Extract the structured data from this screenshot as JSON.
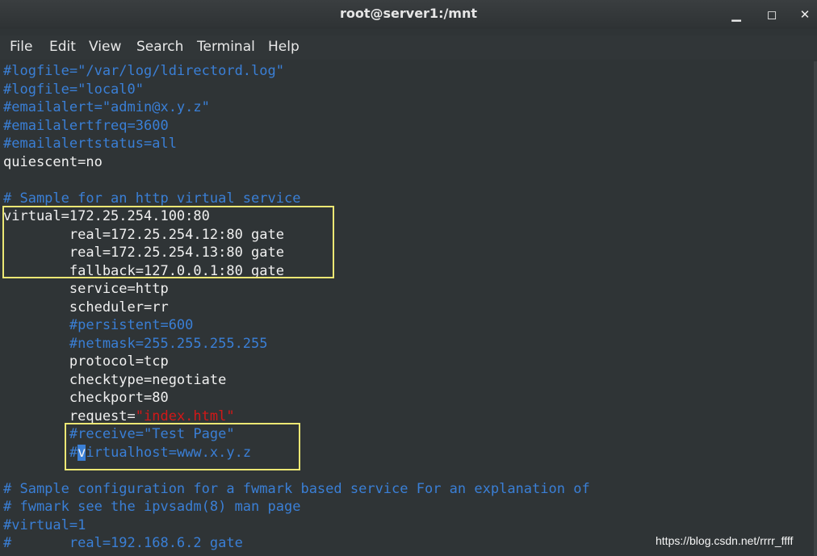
{
  "window": {
    "title": "root@server1:/mnt",
    "minimize_icon": "minimize-icon",
    "maximize_icon": "maximize-icon",
    "close_icon": "close-icon",
    "minimize_glyph": "▁",
    "maximize_glyph": "◻",
    "close_glyph": "✕"
  },
  "menu": [
    "File",
    "Edit",
    "View",
    "Search",
    "Terminal",
    "Help"
  ],
  "terminal": {
    "lines": [
      "#logfile=\"/var/log/ldirectord.log\"",
      "#logfile=\"local0\"",
      "#emailalert=\"admin@x.y.z\"",
      "#emailalertfreq=3600",
      "#emailalertstatus=all",
      "quiescent=no",
      "",
      "# Sample for an http virtual service",
      "virtual=172.25.254.100:80",
      "        real=172.25.254.12:80 gate",
      "        real=172.25.254.13:80 gate",
      "        fallback=127.0.0.1:80 gate",
      "        service=http",
      "        scheduler=rr",
      "        #persistent=600",
      "        #netmask=255.255.255.255",
      "        protocol=tcp",
      "        checktype=negotiate",
      "        checkport=80",
      "        request=",
      "        #receive=\"Test Page\"",
      "        #",
      "",
      "# Sample configuration for a fwmark based service For an explanation of",
      "# fwmark see the ipvsadm(8) man page",
      "#virtual=1",
      "#       real=192.168.6.2 gate"
    ],
    "request_value": "\"index.html\"",
    "cursor_char": "v",
    "virtualhost_rest": "irtualhost=www.x.y.z"
  },
  "watermark": "https://blog.csdn.net/rrrr_ffff",
  "colors": {
    "comment": "#3a7fd6",
    "text": "#f0f0f0",
    "string": "#d21818",
    "highlight_box": "#ece774",
    "background": "#2f3436"
  }
}
